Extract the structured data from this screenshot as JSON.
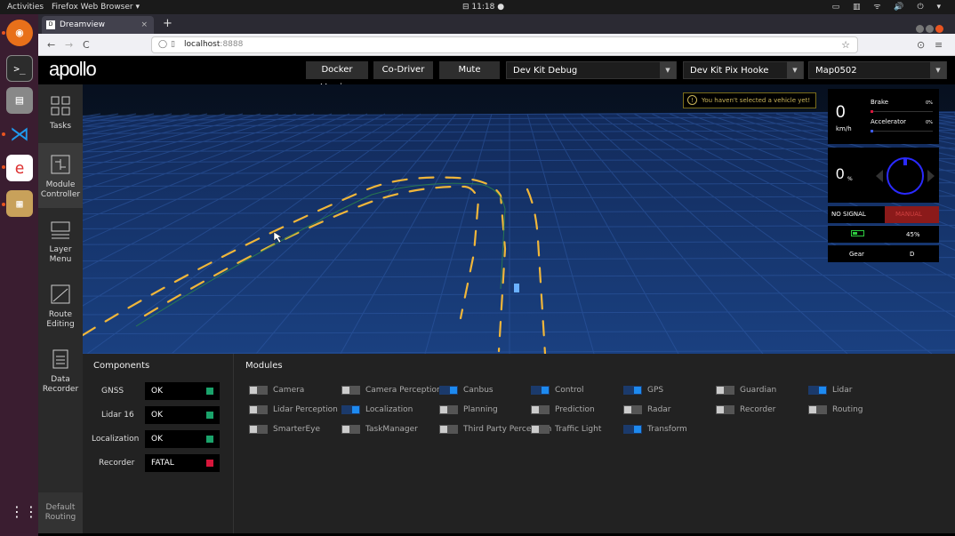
{
  "system": {
    "activities": "Activities",
    "app_name": "Firefox Web Browser ▾",
    "clock": "⊟ 11:18 ●",
    "tray": "▭ ▥ ᯤ 🔊 ⏻ ▾"
  },
  "browser": {
    "tab_title": "Dreamview",
    "tab_close": "×",
    "new_tab": "+",
    "back": "←",
    "forward": "→",
    "reload": "C",
    "url_host": "localhost",
    "url_port": ":8888",
    "star": "☆",
    "pocket": "⊙",
    "menu": "≡"
  },
  "header": {
    "logo": "apollo",
    "buttons": [
      "Docker Version",
      "Co-Driver",
      "Mute"
    ],
    "selects": [
      "Dev Kit Debug",
      "Dev Kit Pix Hooke",
      "Map0502"
    ]
  },
  "sidebar": {
    "items": [
      {
        "label": "Tasks",
        "icon": "tasks-icon",
        "active": false
      },
      {
        "label": "Module Controller",
        "icon": "module-controller-icon",
        "active": true
      },
      {
        "label": "Layer Menu",
        "icon": "layer-menu-icon",
        "active": false
      },
      {
        "label": "Route Editing",
        "icon": "route-editing-icon",
        "active": false
      },
      {
        "label": "Data Recorder",
        "icon": "data-recorder-icon",
        "active": false
      }
    ],
    "default_routing": "Default Routing"
  },
  "warning": "You haven't selected a vehicle yet!",
  "dashboard": {
    "speed": "0",
    "speed_unit": "km/h",
    "brake_label": "Brake",
    "brake_value": "0%",
    "accelerator_label": "Accelerator",
    "accelerator_value": "0%",
    "steering": "0",
    "steering_unit": "%",
    "signal": "NO SIGNAL",
    "mode": "MANUAL",
    "battery": "45%",
    "battery_level": 0.45,
    "gear_label": "Gear",
    "gear_value": "D"
  },
  "components": {
    "title": "Components",
    "rows": [
      {
        "name": "GNSS",
        "status": "OK",
        "color": "#1aa36b"
      },
      {
        "name": "Lidar 16",
        "status": "OK",
        "color": "#1aa36b"
      },
      {
        "name": "Localization",
        "status": "OK",
        "color": "#1aa36b"
      },
      {
        "name": "Recorder",
        "status": "FATAL",
        "color": "#d6163b"
      }
    ]
  },
  "modules": {
    "title": "Modules",
    "items": [
      {
        "label": "Camera",
        "on": false
      },
      {
        "label": "Camera Perception",
        "on": false
      },
      {
        "label": "Canbus",
        "on": true
      },
      {
        "label": "Control",
        "on": true
      },
      {
        "label": "GPS",
        "on": true
      },
      {
        "label": "Guardian",
        "on": false
      },
      {
        "label": "Lidar",
        "on": true
      },
      {
        "label": "Lidar Perception",
        "on": false
      },
      {
        "label": "Localization",
        "on": true
      },
      {
        "label": "Planning",
        "on": false
      },
      {
        "label": "Prediction",
        "on": false
      },
      {
        "label": "Radar",
        "on": false
      },
      {
        "label": "Recorder",
        "on": false
      },
      {
        "label": "Routing",
        "on": false
      },
      {
        "label": "SmarterEye",
        "on": false
      },
      {
        "label": "TaskManager",
        "on": false
      },
      {
        "label": "Third Party Perception",
        "on": false
      },
      {
        "label": "Traffic Light",
        "on": false
      },
      {
        "label": "Transform",
        "on": true
      }
    ]
  },
  "colors": {
    "accent_blue": "#1d8af0",
    "ok_green": "#1aa36b",
    "fatal_red": "#d6163b",
    "lane_yellow": "#f0b63a",
    "manual_red": "#8b1a1a"
  }
}
